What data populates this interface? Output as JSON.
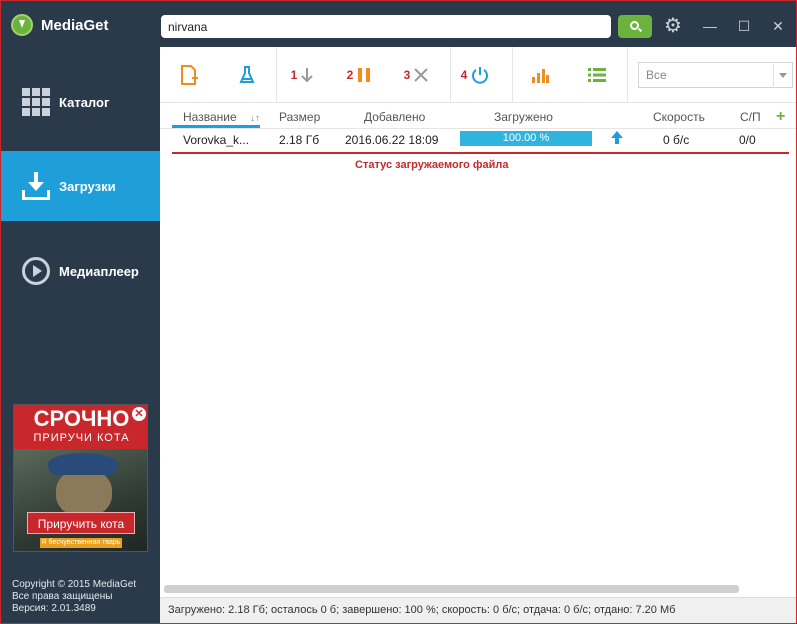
{
  "app": {
    "name": "MediaGet"
  },
  "sidebar": {
    "items": [
      {
        "label": "Каталог",
        "icon": "catalog-grid-icon"
      },
      {
        "label": "Загрузки",
        "icon": "download-icon",
        "active": true
      },
      {
        "label": "Медиаплеер",
        "icon": "play-circle-icon"
      }
    ],
    "ad": {
      "title": "СРОЧНО",
      "subtitle": "ПРИРУЧИ КОТА",
      "button": "Приручить кота",
      "note": "Я бесчувственная тварь",
      "close": "✕"
    },
    "copyright": {
      "line1": "Copyright © 2015 MediaGet",
      "line2": "Все права защищены",
      "line3": "Версия: 2.01.3489"
    }
  },
  "topbar": {
    "search_value": "nirvana",
    "gear": "⚙",
    "minimize": "—",
    "maximize": "☐",
    "close": "✕"
  },
  "toolbar": {
    "markers": [
      "1",
      "2",
      "3",
      "4"
    ],
    "filter_value": "Все",
    "colors": {
      "orange": "#f28c1e",
      "blue": "#1e9fd9",
      "green": "#6cb33e",
      "red": "#c8282c"
    }
  },
  "table": {
    "columns": [
      "Название",
      "Размер",
      "Добавлено",
      "Загружено",
      "Скорость",
      "С/П"
    ],
    "sort_glyph": "↓↑",
    "add_column": "+",
    "rows": [
      {
        "name": "Vorovka_k...",
        "size": "2.18 Гб",
        "added": "2016.06.22 18:09",
        "progress": 1.0,
        "progress_label": "100.00 %",
        "speed": "0 б/с",
        "sp": "0/0"
      }
    ],
    "annotation": "Статус загружаемого файла"
  },
  "statusbar": {
    "text": "Загружено: 2.18 Гб; осталось 0 б; завершено: 100 %; скорость: 0 б/с; отдача: 0 б/с; отдано: 7.20 Мб"
  }
}
